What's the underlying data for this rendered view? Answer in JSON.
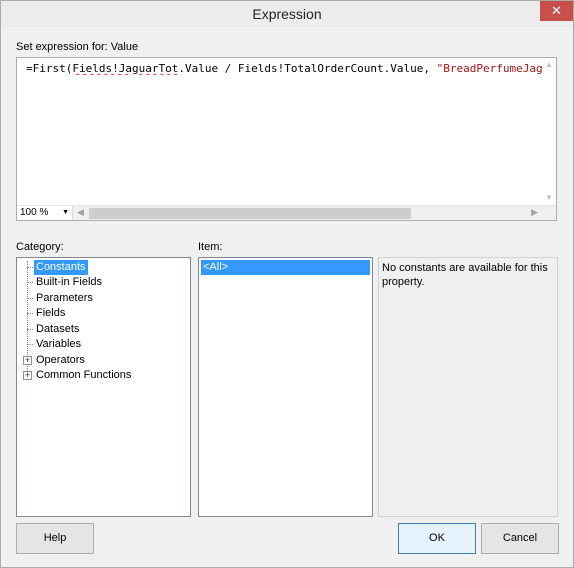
{
  "window": {
    "title": "Expression",
    "close_glyph": "✕"
  },
  "expression": {
    "label": "Set expression for: Value",
    "code_prefix": "=First(",
    "code_field1": "Fields!JaguarTot",
    "code_middle": ".Value / Fields!TotalOrderCount.Value, ",
    "code_string": "\"BreadPerfumeJaguar\"",
    "zoom": "100 %"
  },
  "category": {
    "label": "Category:",
    "items": [
      {
        "label": "Constants",
        "selected": true,
        "expandable": false
      },
      {
        "label": "Built-in Fields",
        "selected": false,
        "expandable": false
      },
      {
        "label": "Parameters",
        "selected": false,
        "expandable": false
      },
      {
        "label": "Fields",
        "selected": false,
        "expandable": false
      },
      {
        "label": "Datasets",
        "selected": false,
        "expandable": false
      },
      {
        "label": "Variables",
        "selected": false,
        "expandable": false
      },
      {
        "label": "Operators",
        "selected": false,
        "expandable": true
      },
      {
        "label": "Common Functions",
        "selected": false,
        "expandable": true
      }
    ]
  },
  "item": {
    "label": "Item:",
    "values": [
      "<All>"
    ]
  },
  "description": "No constants are available for this property.",
  "buttons": {
    "help": "Help",
    "ok": "OK",
    "cancel": "Cancel"
  }
}
